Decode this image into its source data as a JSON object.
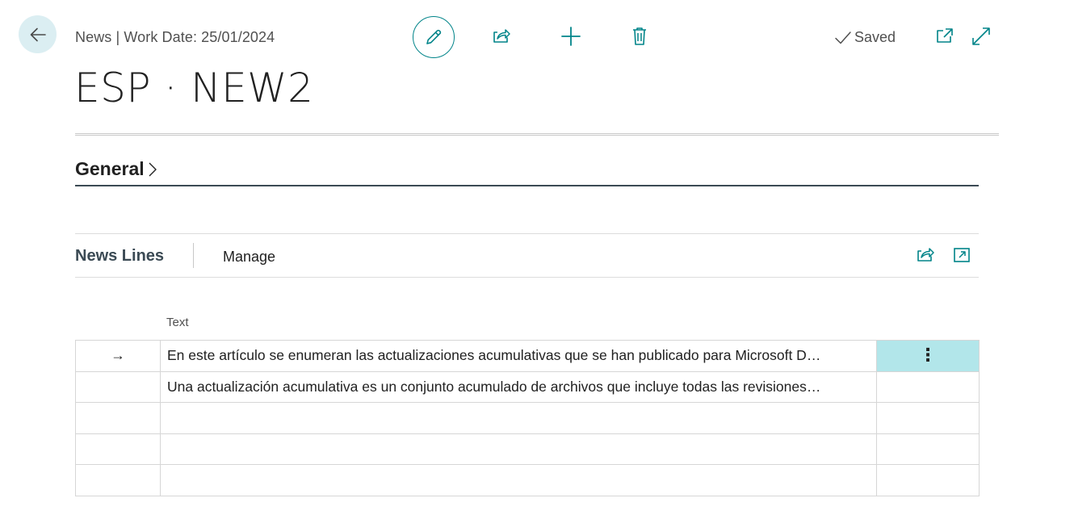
{
  "header": {
    "caption": "News | Work Date: 25/01/2024",
    "saved_label": "Saved"
  },
  "page": {
    "title": "ESP · NEW2"
  },
  "general": {
    "label": "General"
  },
  "news_lines": {
    "title": "News Lines",
    "manage_label": "Manage",
    "column_header": "Text",
    "rows": [
      {
        "marker": "→",
        "text": "En este artículo se enumeran las actualizaciones acumulativas que se han publicado para Microsoft D…",
        "selected": true
      },
      {
        "marker": "",
        "text": "Una actualización acumulativa es un conjunto acumulado de archivos que incluye todas las revisiones…",
        "selected": false
      },
      {
        "marker": "",
        "text": "",
        "selected": false
      },
      {
        "marker": "",
        "text": "",
        "selected": false
      },
      {
        "marker": "",
        "text": "",
        "selected": false
      }
    ]
  },
  "icons": {
    "back": "arrow-left-icon",
    "edit": "pencil-icon",
    "share": "share-icon",
    "new": "plus-icon",
    "delete": "trash-icon",
    "saved": "checkmark-icon",
    "open_new_window": "open-in-new-window-icon",
    "expand": "expand-icon",
    "general_chevron": "chevron-right-icon",
    "row_actions": "more-vertical-icon"
  },
  "colors": {
    "accent": "#008489",
    "back_button_bg": "#dbeef2",
    "selected_cell_bg": "#b2e6ea",
    "section_line": "#3b4a54"
  }
}
